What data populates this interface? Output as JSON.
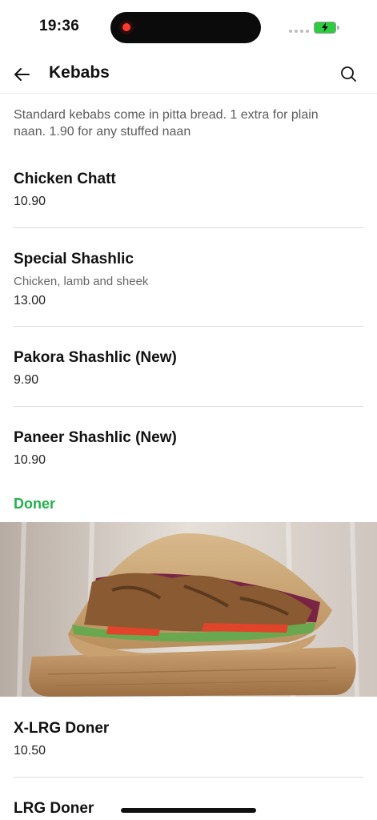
{
  "status": {
    "time": "19:36"
  },
  "nav": {
    "title": "Kebabs"
  },
  "intro": "Standard kebabs come in pitta bread. 1 extra for plain naan. 1.90 for any stuffed naan",
  "items": [
    {
      "name": "Chicken Chatt",
      "price": "10.90"
    },
    {
      "name": "Special Shashlic",
      "description": "Chicken, lamb and sheek",
      "price": "13.00"
    },
    {
      "name": "Pakora Shashlic (New)",
      "price": "9.90"
    },
    {
      "name": "Paneer Shashlic (New)",
      "price": "10.90"
    }
  ],
  "section": {
    "title": "Doner"
  },
  "doner_items": [
    {
      "name": "X-LRG Doner",
      "price": "10.50"
    },
    {
      "name": "LRG Doner"
    }
  ],
  "colors": {
    "accent": "#22b24c",
    "battery": "#2ecc40",
    "recording": "#ff3b30"
  },
  "icons": {
    "back": "arrow-left-icon",
    "search": "search-icon",
    "hero": "doner-kebab-photo"
  }
}
